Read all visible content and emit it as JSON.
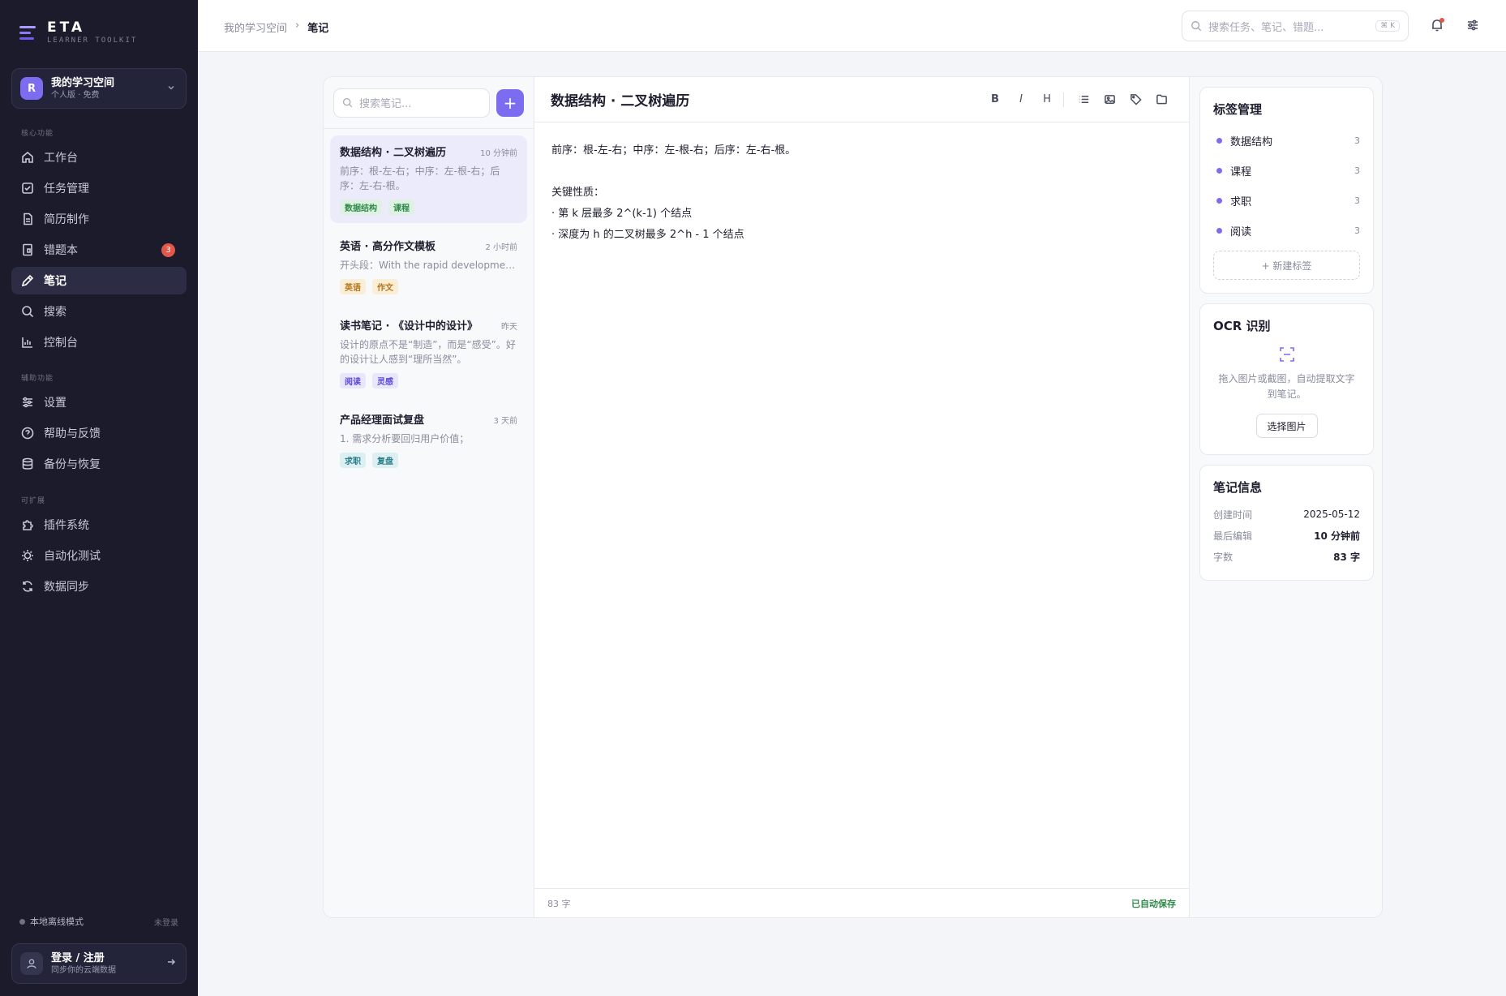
{
  "brand": {
    "name": "ETA",
    "subtitle": "LEARNER TOOLKIT"
  },
  "workspace": {
    "avatar": "R",
    "name": "我的学习空间",
    "plan": "个人版 · 免费"
  },
  "sidebar": {
    "sections": [
      "核心功能",
      "辅助功能",
      "可扩展"
    ],
    "items": [
      {
        "label": "工作台",
        "icon": "home-icon"
      },
      {
        "label": "任务管理",
        "icon": "checkbox-icon"
      },
      {
        "label": "简历制作",
        "icon": "document-icon"
      },
      {
        "label": "错题本",
        "icon": "notebook-icon",
        "badge": "3"
      },
      {
        "label": "笔记",
        "icon": "pen-icon",
        "active": true
      },
      {
        "label": "搜索",
        "icon": "search-icon"
      },
      {
        "label": "控制台",
        "icon": "chart-icon"
      },
      {
        "label": "设置",
        "icon": "sliders-icon"
      },
      {
        "label": "帮助与反馈",
        "icon": "help-icon"
      },
      {
        "label": "备份与恢复",
        "icon": "database-icon"
      },
      {
        "label": "插件系统",
        "icon": "puzzle-icon"
      },
      {
        "label": "自动化测试",
        "icon": "bug-icon"
      },
      {
        "label": "数据同步",
        "icon": "sync-icon"
      }
    ],
    "offline_label": "本地离线模式",
    "offline_status": "未登录",
    "login_title": "登录 / 注册",
    "login_subtitle": "同步你的云端数据"
  },
  "topbar": {
    "breadcrumb_root": "我的学习空间",
    "breadcrumb_current": "笔记",
    "search_placeholder": "搜索任务、笔记、错题...",
    "search_shortcut": "⌘ K"
  },
  "notes": {
    "search_placeholder": "搜索笔记...",
    "add_label": "+",
    "list": [
      {
        "title": "数据结构 · 二叉树遍历",
        "time": "10 分钟前",
        "preview": "前序：根-左-右；中序：左-根-右；后序：左-右-根。",
        "tags": [
          "数据结构",
          "课程"
        ]
      },
      {
        "title": "英语 · 高分作文模板",
        "time": "2 小时前",
        "preview": "开头段：With the rapid development of…",
        "tags": [
          "英语",
          "作文"
        ]
      },
      {
        "title": "读书笔记 · 《设计中的设计》",
        "time": "昨天",
        "preview": "设计的原点不是“制造”，而是“感受”。好的设计让人感到“理所当然”。",
        "tags": [
          "阅读",
          "灵感"
        ]
      },
      {
        "title": "产品经理面试复盘",
        "time": "3 天前",
        "preview": "1. 需求分析要回归用户价值；",
        "tags": [
          "求职",
          "复盘"
        ]
      }
    ]
  },
  "editor": {
    "title": "数据结构 · 二叉树遍历",
    "tools": {
      "bold": "B",
      "italic": "I",
      "heading": "H"
    },
    "lines": [
      "前序：根-左-右；中序：左-根-右；后序：左-右-根。",
      "",
      "关键性质：",
      "· 第 k 层最多 2^(k-1) 个结点",
      "· 深度为 h 的二叉树最多 2^h - 1 个结点"
    ],
    "word_count": "83 字",
    "autosave": "已自动保存"
  },
  "tag_panel": {
    "title": "标签管理",
    "tags": [
      {
        "name": "数据结构",
        "count": "3"
      },
      {
        "name": "课程",
        "count": "3"
      },
      {
        "name": "求职",
        "count": "3"
      },
      {
        "name": "阅读",
        "count": "3"
      }
    ],
    "new_tag": "+ 新建标签"
  },
  "ocr_panel": {
    "title": "OCR 识别",
    "desc_line1": "拖入图片或截图，自动提取文字",
    "desc_line2": "到笔记。",
    "button": "选择图片"
  },
  "info_panel": {
    "title": "笔记信息",
    "rows": [
      {
        "label": "创建时间",
        "value": "2025-05-12"
      },
      {
        "label": "最后编辑",
        "value": "10 分钟前"
      },
      {
        "label": "字数",
        "value": "83 字"
      }
    ]
  },
  "colors": {
    "accent": "#7c6cf0",
    "sidebar_bg": "#1b1b2b",
    "badge": "#e2574c",
    "autosave": "#2f8a4a"
  }
}
